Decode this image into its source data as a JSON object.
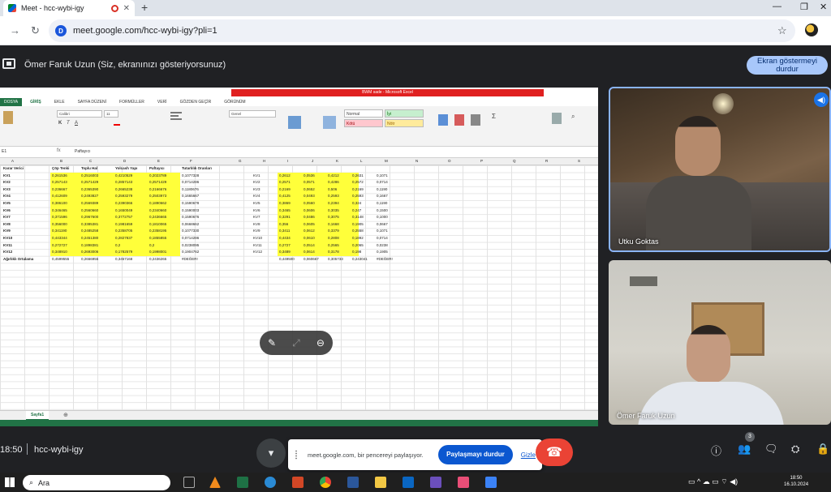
{
  "browser": {
    "tab_title": "Meet - hcc-wybi-igy",
    "url": "meet.google.com/hcc-wybi-igy?pli=1",
    "site_icon_letter": "D"
  },
  "meet": {
    "presenter_text": "Ömer Faruk Uzun (Siz, ekranınızı gösteriyorsunuz)",
    "stop_presenting_line1": "Ekran göstermeyi",
    "stop_presenting_line2": "durdur",
    "participants": [
      {
        "name": "Utku Goktas"
      },
      {
        "name": "Ömer Faruk Uzun"
      }
    ],
    "time": "18:50",
    "meeting_code": "hcc-wybi-igy",
    "people_count": "3",
    "share_banner": {
      "message": "meet.google.com, bir pencereyi paylaşıyor.",
      "stop_label": "Paylaşmayı durdur",
      "hide_label": "Gizle"
    }
  },
  "excel": {
    "window_title": "BWM sade - Microsoft Excel",
    "tabs": [
      "DOSYA",
      "GİRİŞ",
      "EKLE",
      "SAYFA DÜZENİ",
      "FORMÜLLER",
      "VERİ",
      "GÖZDEN GEÇİR",
      "GÖRÜNÜM"
    ],
    "name_box": "E1",
    "formula": "Paftayıcı",
    "font_name": "Calibri",
    "font_size": "11",
    "number_format": "Genel",
    "styles": {
      "normal": "Normal",
      "bad": "Kötü",
      "good": "İyi",
      "neutral": "Nötr"
    },
    "columns": [
      "A",
      "B",
      "C",
      "D",
      "E",
      "F",
      "G",
      "H",
      "I",
      "J",
      "K",
      "L",
      "M",
      "N",
      "O",
      "P",
      "Q",
      "R",
      "S",
      "T"
    ],
    "headers": [
      "Karar Verici",
      "Çöp Tenki",
      "Toplu Hal",
      "Yolcash Yapı",
      "Paftayıcı",
      "Tutarlılık Oranları"
    ],
    "rows": [
      [
        "KV1",
        "0,261536",
        "0,2516003",
        "0,4210529",
        "0,2023789",
        "0,1077328"
      ],
      [
        "KV2",
        "0,257143",
        "0,2571429",
        "0,2857143",
        "0,2571429",
        "0,0714286"
      ],
      [
        "KV3",
        "0,236667",
        "0,2365390",
        "0,2665238",
        "0,2166676",
        "0,1180676"
      ],
      [
        "KV4",
        "0,412609",
        "0,2493827",
        "0,2593279",
        "0,2503973",
        "0,1665667"
      ],
      [
        "KV5",
        "0,386100",
        "0,2569389",
        "0,2390366",
        "0,1890662",
        "0,1590678"
      ],
      [
        "KV6",
        "0,346465",
        "0,2560660",
        "0,1650049",
        "0,2340660",
        "0,1590003"
      ],
      [
        "KV7",
        "0,371596",
        "0,2967600",
        "0,3772757",
        "0,2436665",
        "0,1590676"
      ],
      [
        "KV8",
        "0,356000",
        "0,3385381",
        "0,1981659",
        "0,1810065",
        "0,0668662"
      ],
      [
        "KV9",
        "0,341190",
        "0,2485258",
        "0,2358705",
        "0,2358195",
        "0,1077330"
      ],
      [
        "KV10",
        "0,443344",
        "0,2451380",
        "0,2827837",
        "0,1855855",
        "0,0714286"
      ],
      [
        "KV11",
        "0,272727",
        "0,1898381",
        "0,2",
        "0,2",
        "0,0238095"
      ],
      [
        "KV12",
        "0,348910",
        "0,2693006",
        "0,1782579",
        "0,1998001",
        "0,1904762"
      ]
    ],
    "average_label": "Ağırlıklı Ortalama",
    "averages": [
      "0,4599555",
      "0,2666955",
      "0,3457168",
      "0,2436265",
      "#DEĞER!"
    ],
    "right_table": {
      "labels": [
        "KV1",
        "KV2",
        "KV3",
        "KV4",
        "KV5",
        "KV6",
        "KV7",
        "KV8",
        "KV9",
        "KV10",
        "KV11",
        "KV12"
      ],
      "rows": [
        [
          "0,2612",
          "0,0536",
          "0,4212",
          "0,2631",
          "0,1071"
        ],
        [
          "0,2571",
          "0,0571",
          "0,4286",
          "0,2572",
          "0,0714"
        ],
        [
          "0,2169",
          "0,0652",
          "0,506",
          "0,2169",
          "0,1190"
        ],
        [
          "0,4125",
          "0,0493",
          "0,2593",
          "0,2593",
          "0,1667"
        ],
        [
          "0,3869",
          "0,0560",
          "0,2394",
          "0,324",
          "0,1190"
        ],
        [
          "0,3465",
          "0,0606",
          "0,3035",
          "0,247",
          "0,1500"
        ],
        [
          "0,3291",
          "0,0486",
          "0,3075",
          "0,3148",
          "0,1000"
        ],
        [
          "0,356",
          "0,0605",
          "0,1668",
          "0,1905",
          "0,0667"
        ],
        [
          "0,3411",
          "0,0612",
          "0,3379",
          "0,2558",
          "0,1071"
        ],
        [
          "0,4434",
          "0,0610",
          "0,2808",
          "0,1892",
          "0,0714"
        ],
        [
          "0,2727",
          "0,0514",
          "0,2565",
          "0,2065",
          "0,0238"
        ],
        [
          "0,3489",
          "0,0614",
          "0,3178",
          "0,198",
          "0,1905"
        ]
      ],
      "averages": [
        "0,449500",
        "0,060667",
        "0,305733",
        "0,243041",
        "#DEĞER!"
      ]
    },
    "sheet_name": "Sayfa1"
  },
  "taskbar": {
    "search_placeholder": "Ara",
    "time": "18:50",
    "date": "16.10.2024"
  },
  "colors": {
    "meet_bg": "#202124",
    "highlight_yellow": "#ffff3a",
    "excel_green": "#217346",
    "end_call_red": "#ea4335",
    "stop_share_blue": "#0b57d0"
  }
}
